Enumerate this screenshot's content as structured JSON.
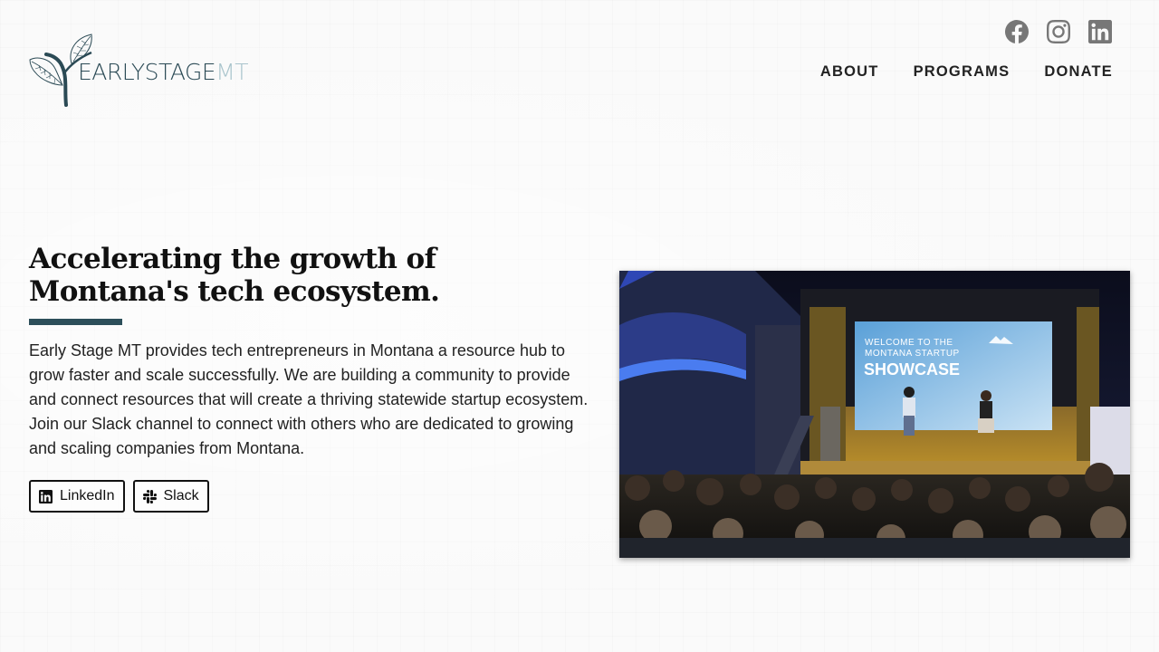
{
  "brand": {
    "logo_dark": "EARLYSTAGE",
    "logo_light": "MT",
    "colors": {
      "dark": "#2b4a55",
      "light": "#a9c4cc",
      "accent": "#2d4f5a"
    }
  },
  "social": [
    {
      "icon": "facebook-icon"
    },
    {
      "icon": "instagram-icon"
    },
    {
      "icon": "linkedin-icon"
    }
  ],
  "nav": {
    "about": "ABOUT",
    "programs": "PROGRAMS",
    "donate": "DONATE"
  },
  "hero": {
    "headline": "Accelerating the growth of Montana's tech ecosystem.",
    "body": "Early Stage MT provides tech entrepreneurs in Montana a resource hub to grow faster and scale successfully. We are building a community to provide and connect resources that will create a thriving statewide startup ecosystem. Join our Slack channel to connect with others who are dedicated to growing and scaling companies from Montana.",
    "buttons": {
      "linkedin": "LinkedIn",
      "slack": "Slack"
    }
  },
  "photo": {
    "screen_line1": "WELCOME TO THE",
    "screen_line2": "MONTANA STARTUP",
    "screen_title": "SHOWCASE"
  }
}
